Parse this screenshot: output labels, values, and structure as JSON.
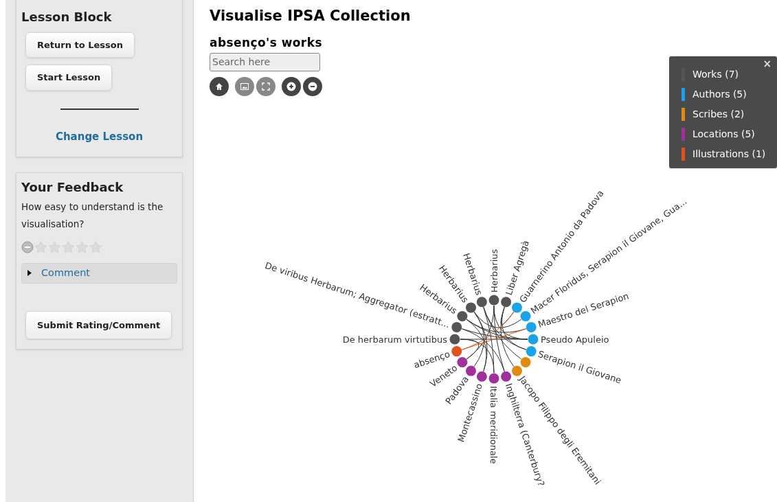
{
  "sidebar": {
    "lesson_block": {
      "title": "Lesson Block",
      "buttons": [
        "Return to Lesson",
        "Start Lesson"
      ],
      "link": "Change Lesson"
    },
    "feedback": {
      "title": "Your Feedback",
      "question": "How easy to understand is the visualisation?",
      "stars": 0,
      "comment": {
        "label": "Comment",
        "expanded": false
      },
      "submit": "Submit Rating/Comment"
    }
  },
  "main": {
    "title": "Visualise IPSA Collection",
    "subtitle": "absenço's works",
    "search": {
      "placeholder": "Search here"
    },
    "tools": [
      {
        "kind": "home",
        "disabled": false
      },
      {
        "kind": "image",
        "disabled": true
      },
      {
        "kind": "fullscreen",
        "disabled": true
      },
      {
        "kind": "zoom-in",
        "disabled": false
      },
      {
        "kind": "zoom-out",
        "disabled": false
      }
    ],
    "legend": {
      "close": "×",
      "items": [
        {
          "kind": "work",
          "label": "Works (7)",
          "color": "#555555"
        },
        {
          "kind": "author",
          "label": "Authors (5)",
          "color": "#1aa3e8"
        },
        {
          "kind": "scribe",
          "label": "Scribes (2)",
          "color": "#e08a12"
        },
        {
          "kind": "location",
          "label": "Locations (5)",
          "color": "#a0309a"
        },
        {
          "kind": "illustration",
          "label": "Illustrations (1)",
          "color": "#e0531a"
        }
      ]
    },
    "graph": {
      "nodes": [
        {
          "kind": "work",
          "label": "De herbarum virtutibus"
        },
        {
          "kind": "work",
          "label": "De viribus Herbarum; Aggregator (estratt..."
        },
        {
          "kind": "work",
          "label": "Herbarius"
        },
        {
          "kind": "work",
          "label": "Herbarius"
        },
        {
          "kind": "work",
          "label": "Herbarius"
        },
        {
          "kind": "work",
          "label": "Herbarius"
        },
        {
          "kind": "work",
          "label": "Liber Agregà"
        },
        {
          "kind": "author",
          "label": "Guarnerino Antonio da Padova"
        },
        {
          "kind": "author",
          "label": "Macer Floridus, Serapion il Giovane, Gua..."
        },
        {
          "kind": "author",
          "label": "Maestro del Serapion"
        },
        {
          "kind": "author",
          "label": "Pseudo Apuleio"
        },
        {
          "kind": "author",
          "label": "Serapion il Giovane"
        },
        {
          "kind": "scribe"
        },
        {
          "kind": "scribe",
          "label": "Jacopo Filippo degli Eremitani"
        },
        {
          "kind": "location",
          "label": "Inghilterra (Canterbury?"
        },
        {
          "kind": "location",
          "label": "Italia meridionale"
        },
        {
          "kind": "location",
          "label": "Montecassino"
        },
        {
          "kind": "location",
          "label": "Padova"
        },
        {
          "kind": "location",
          "label": "Veneto"
        },
        {
          "kind": "illustration",
          "label": "absenço"
        }
      ]
    }
  }
}
